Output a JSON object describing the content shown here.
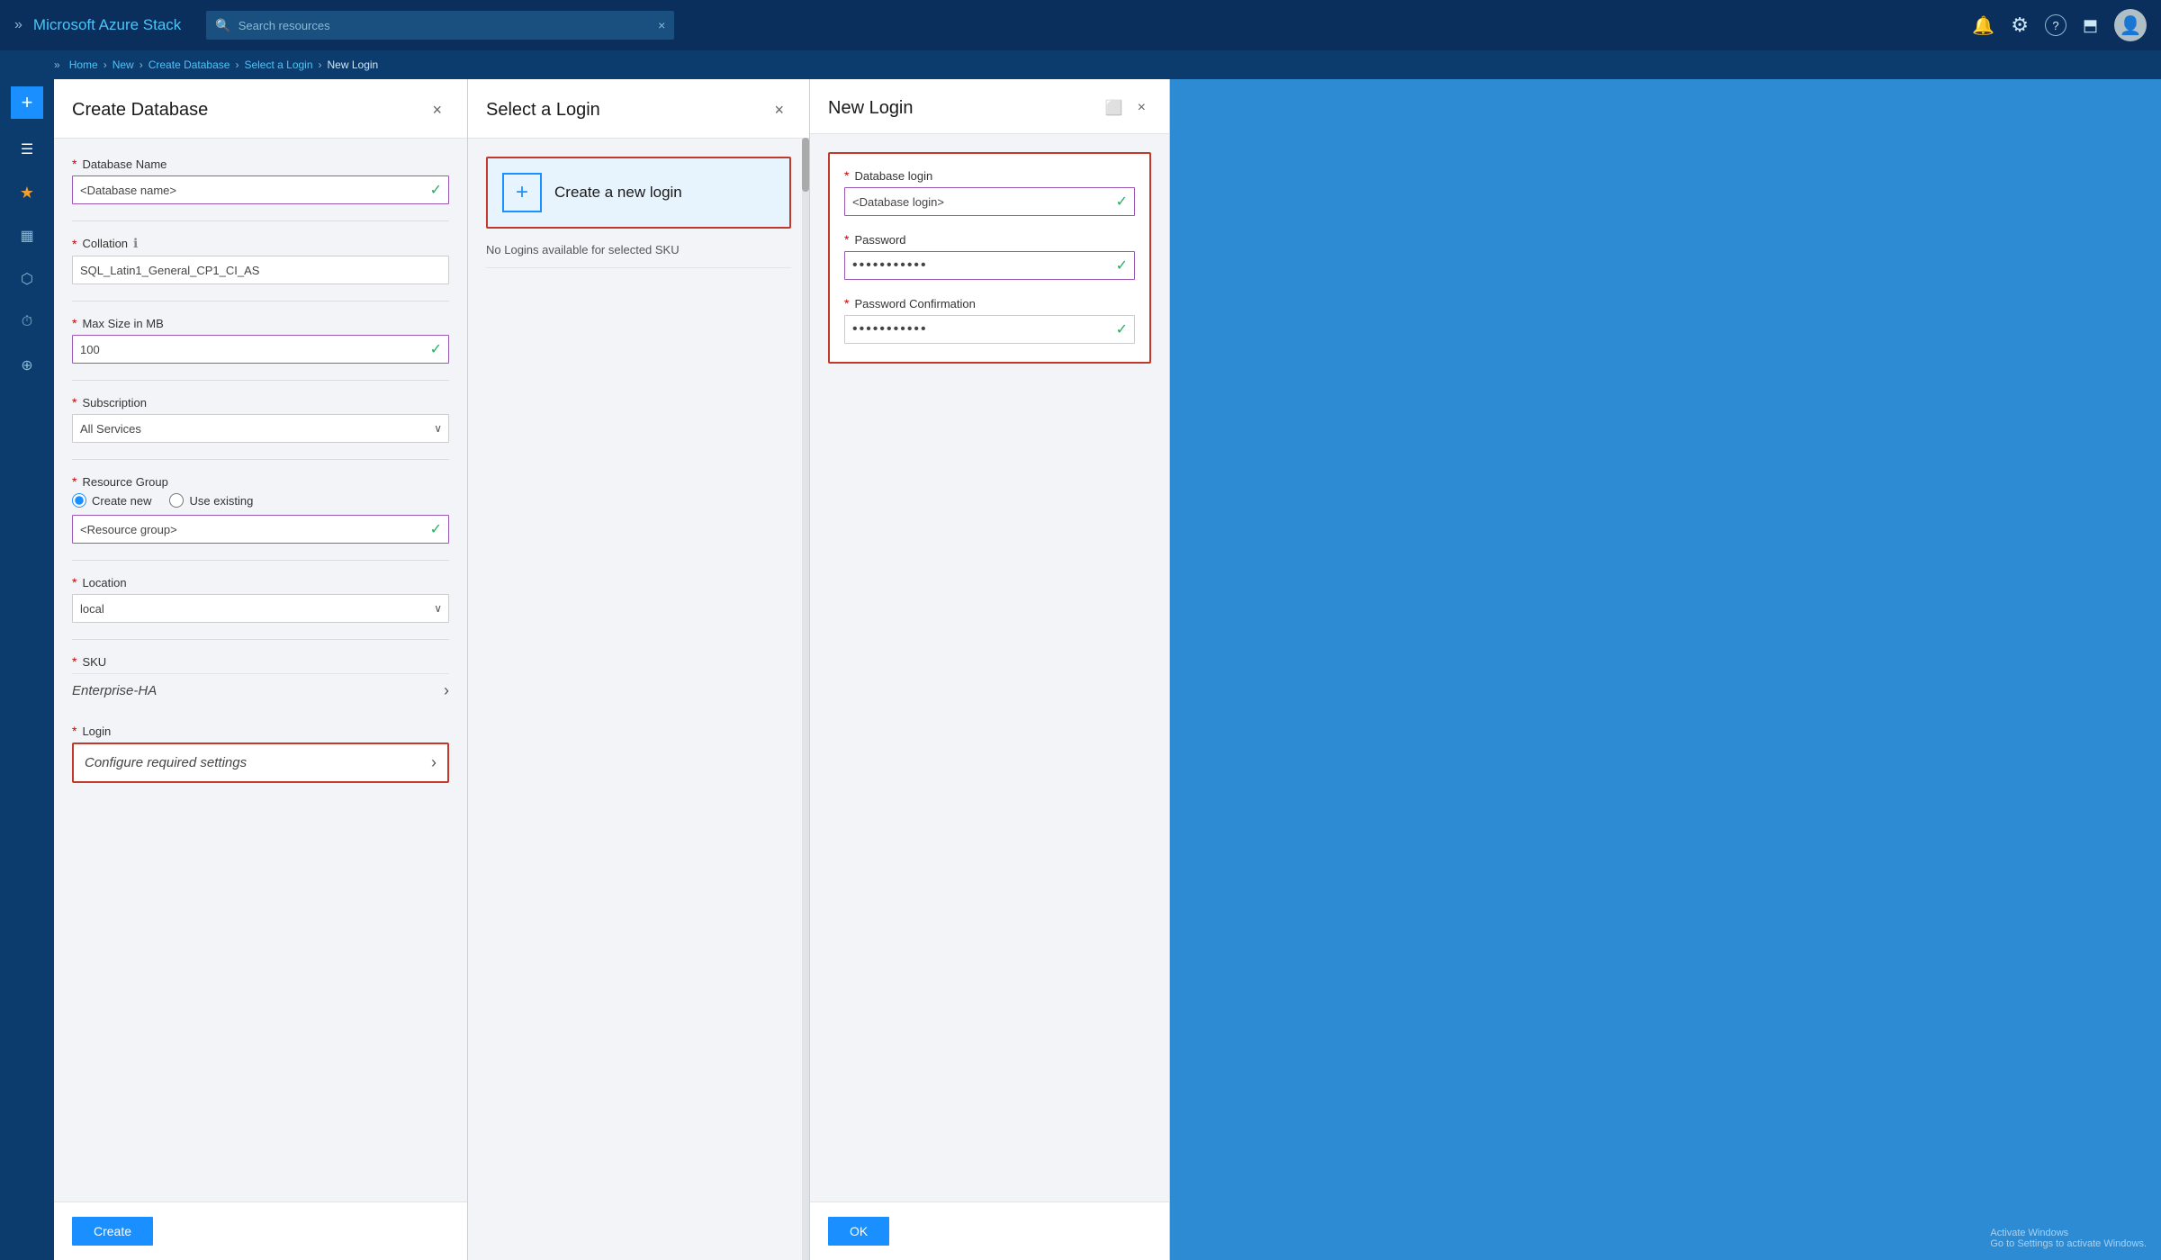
{
  "app": {
    "title": "Microsoft Azure Stack"
  },
  "topbar": {
    "title": "Microsoft Azure Stack",
    "search_placeholder": "Search resources",
    "search_close": "×"
  },
  "breadcrumb": {
    "items": [
      "Home",
      "New",
      "Create Database",
      "Select a Login",
      "New Login"
    ]
  },
  "sidebar": {
    "plus_label": "+",
    "items": [
      {
        "name": "menu",
        "icon": "☰"
      },
      {
        "name": "favorites",
        "icon": "★"
      },
      {
        "name": "dashboard",
        "icon": "▦"
      },
      {
        "name": "resources",
        "icon": "⬡"
      },
      {
        "name": "history",
        "icon": "⏱"
      },
      {
        "name": "globe",
        "icon": "⊕"
      }
    ]
  },
  "panel1": {
    "title": "Create Database",
    "fields": {
      "database_name_label": "Database Name",
      "database_name_value": "<Database name>",
      "collation_label": "Collation",
      "collation_info": "ℹ",
      "collation_value": "SQL_Latin1_General_CP1_CI_AS",
      "max_size_label": "Max Size in MB",
      "max_size_value": "100",
      "subscription_label": "Subscription",
      "subscription_value": "All Services",
      "resource_group_label": "Resource Group",
      "resource_group_create": "Create new",
      "resource_group_use": "Use existing",
      "resource_group_value": "<Resource group>",
      "location_label": "Location",
      "location_value": "local",
      "sku_label": "SKU",
      "sku_value": "Enterprise-HA",
      "login_label": "Login",
      "login_placeholder": "Configure required settings"
    },
    "footer": {
      "create_button": "Create"
    }
  },
  "panel2": {
    "title": "Select a Login",
    "create_login_label": "Create a new login",
    "no_logins_text": "No Logins available for selected SKU"
  },
  "panel3": {
    "title": "New Login",
    "fields": {
      "db_login_label": "Database login",
      "db_login_value": "<Database login>",
      "password_label": "Password",
      "password_value": "••••••••••",
      "password_confirm_label": "Password Confirmation",
      "password_confirm_value": "••••••••••"
    },
    "footer": {
      "ok_button": "OK"
    }
  },
  "icons": {
    "search": "🔍",
    "bell": "🔔",
    "gear": "⚙",
    "question": "?",
    "feedback": "📤",
    "check": "✓",
    "chevron_right": "›",
    "chevron_down": "∨",
    "close": "×",
    "plus": "+",
    "maximize": "⬜"
  },
  "colors": {
    "accent_blue": "#1a8fff",
    "brand_blue": "#0c3b6e",
    "required_red": "#c0392b",
    "success_green": "#27ae60",
    "purple_border": "#9b59b6"
  }
}
